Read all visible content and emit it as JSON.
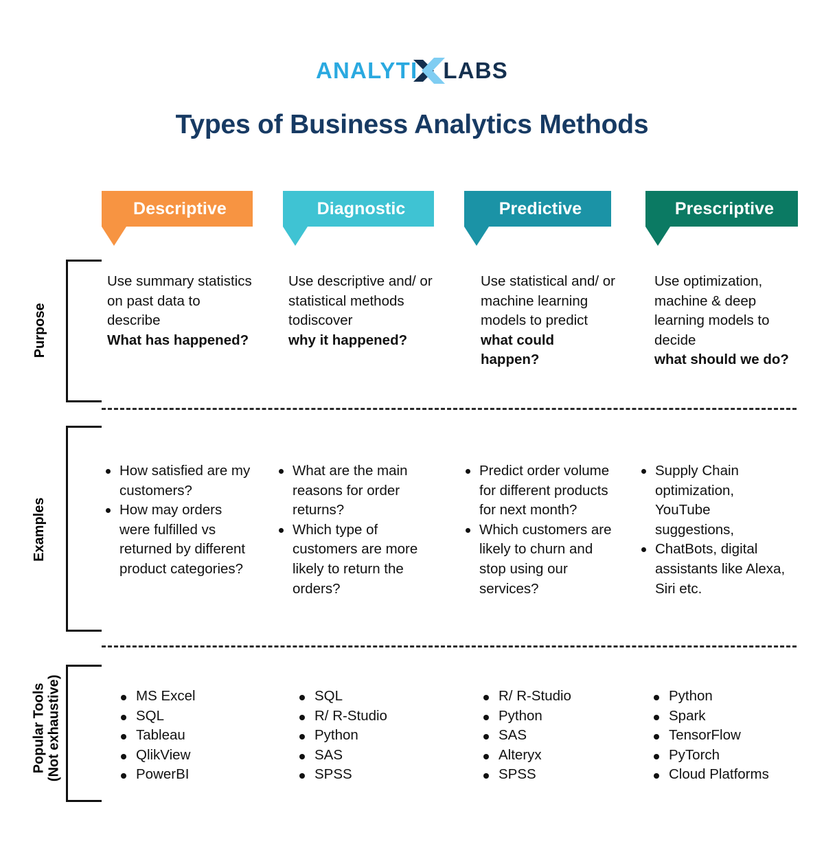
{
  "brand": {
    "name_part1": "ANALYTI",
    "name_part2": "LABS",
    "x_icon": "letter-x-chevron-icon",
    "color_light": "#2aa9e0",
    "color_dark": "#14304f"
  },
  "title": "Types of Business Analytics Methods",
  "title_color": "#173a63",
  "columns": [
    {
      "label": "Descriptive",
      "color": "#f79442"
    },
    {
      "label": "Diagnostic",
      "color": "#3fc3d3"
    },
    {
      "label": "Predictive",
      "color": "#1b93a6"
    },
    {
      "label": "Prescriptive",
      "color": "#0b7a63"
    }
  ],
  "rows": [
    {
      "label": "Purpose",
      "label_line2": ""
    },
    {
      "label": "Examples",
      "label_line2": ""
    },
    {
      "label": "Popular Tools",
      "label_line2": "(Not exhaustive)"
    }
  ],
  "purpose": [
    {
      "normal": "Use summary statistics on past data to describe",
      "bold": "What has happened?"
    },
    {
      "normal": "Use descriptive and/ or statistical methods todiscover",
      "bold": "why it happened?"
    },
    {
      "normal": "Use statistical and/ or machine learning models to predict",
      "bold": "what could happen?"
    },
    {
      "normal": "Use optimization, machine & deep learning models to decide",
      "bold": "what should we do?"
    }
  ],
  "examples": [
    [
      "How satisfied are my customers?",
      "How may orders were fulfilled vs returned by different product categories?"
    ],
    [
      "What are the main reasons for order returns?",
      "Which type of customers are more likely to return the orders?"
    ],
    [
      "Predict order volume for different products for next month?",
      "Which customers are likely to churn and stop using our services?"
    ],
    [
      "Supply Chain optimization, YouTube suggestions,",
      "ChatBots, digital assistants like Alexa, Siri etc."
    ]
  ],
  "tools": [
    [
      "MS Excel",
      "SQL",
      "Tableau",
      "QlikView",
      "PowerBI"
    ],
    [
      "SQL",
      "R/ R-Studio",
      "Python",
      "SAS",
      "SPSS"
    ],
    [
      "R/ R-Studio",
      "Python",
      "SAS",
      "Alteryx",
      "SPSS"
    ],
    [
      "Python",
      "Spark",
      "TensorFlow",
      "PyTorch",
      "Cloud Platforms"
    ]
  ]
}
